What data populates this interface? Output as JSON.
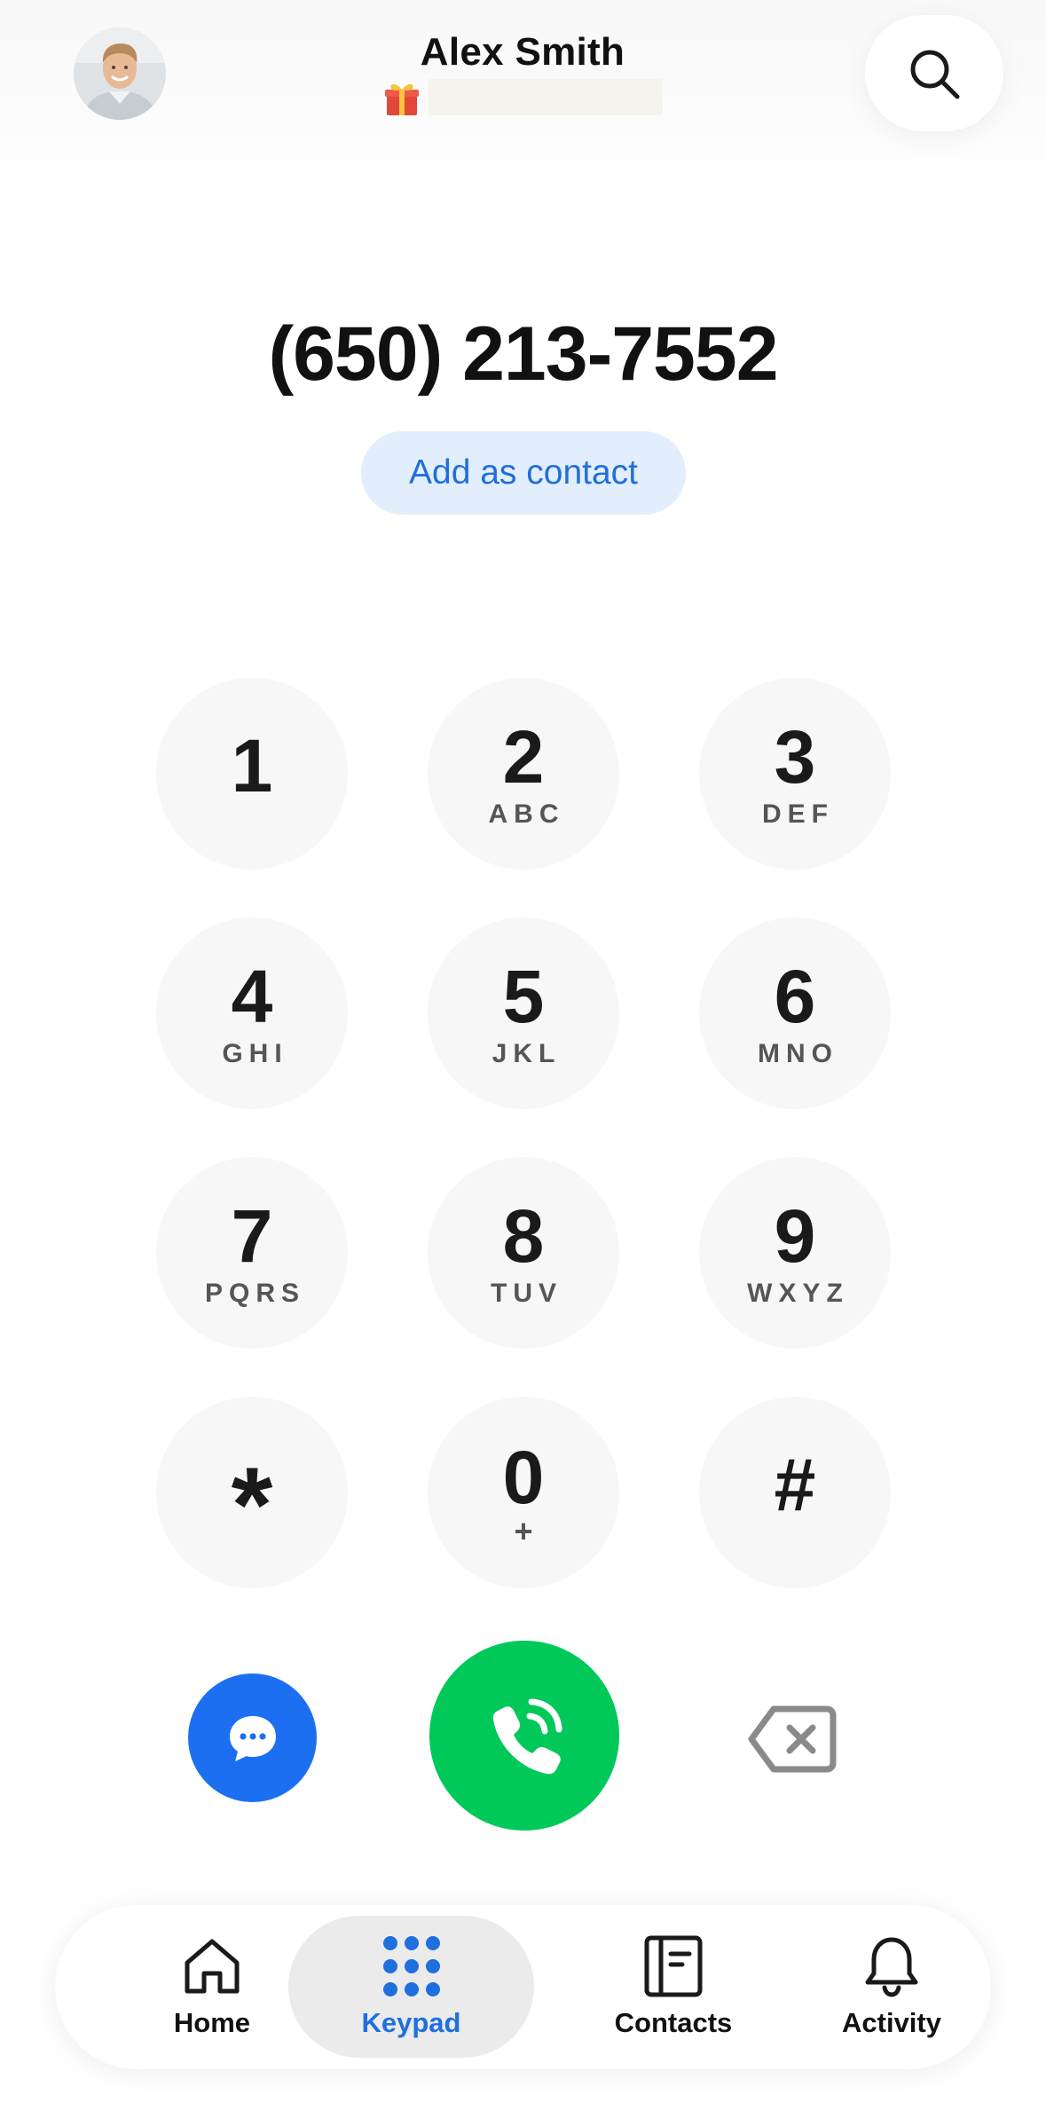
{
  "header": {
    "user_name": "Alex Smith",
    "avatar_icon": "user-avatar-photo",
    "status_icon": "gift-icon",
    "search_icon": "search-icon"
  },
  "dialer": {
    "number": "(650) 213-7552",
    "add_contact_label": "Add as contact"
  },
  "keypad": {
    "keys": [
      {
        "digit": "1",
        "letters": ""
      },
      {
        "digit": "2",
        "letters": "ABC"
      },
      {
        "digit": "3",
        "letters": "DEF"
      },
      {
        "digit": "4",
        "letters": "GHI"
      },
      {
        "digit": "5",
        "letters": "JKL"
      },
      {
        "digit": "6",
        "letters": "MNO"
      },
      {
        "digit": "7",
        "letters": "PQRS"
      },
      {
        "digit": "8",
        "letters": "TUV"
      },
      {
        "digit": "9",
        "letters": "WXYZ"
      },
      {
        "digit": "*",
        "letters": ""
      },
      {
        "digit": "0",
        "letters": "+"
      },
      {
        "digit": "#",
        "letters": ""
      }
    ]
  },
  "actions": {
    "message_icon": "message-bubble-icon",
    "call_icon": "phone-call-icon",
    "backspace_icon": "backspace-icon"
  },
  "bottom_nav": {
    "items": [
      {
        "label": "Home",
        "icon": "home-icon",
        "active": false
      },
      {
        "label": "Keypad",
        "icon": "keypad-icon",
        "active": true
      },
      {
        "label": "Contacts",
        "icon": "contacts-icon",
        "active": false
      },
      {
        "label": "Activity",
        "icon": "bell-icon",
        "active": false
      }
    ]
  },
  "colors": {
    "accent_blue": "#1f6fde",
    "message_blue": "#1d6ff2",
    "call_green": "#00c95a",
    "key_background": "#f7f7f7",
    "add_contact_background": "#e3eefc",
    "active_tab_background": "#ebebeb"
  }
}
